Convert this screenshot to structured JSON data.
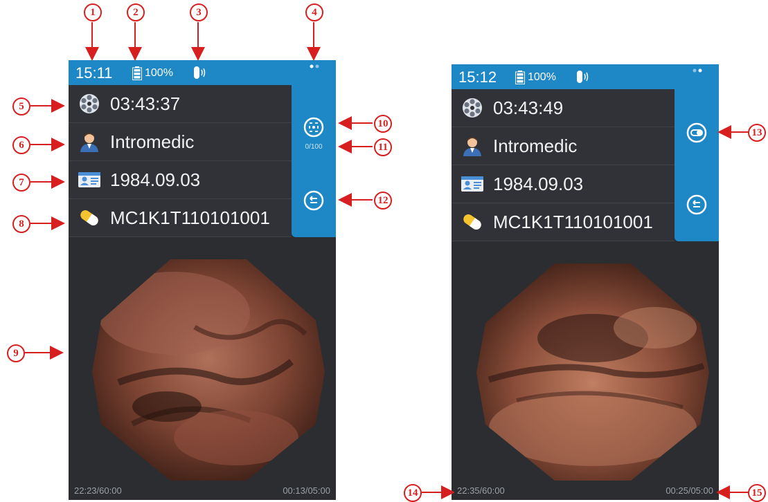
{
  "screen_a": {
    "status": {
      "time": "15:11",
      "battery": "100%"
    },
    "rows": [
      {
        "icon": "film-reel-icon",
        "text": "03:43:37"
      },
      {
        "icon": "user-avatar-icon",
        "text": "Intromedic"
      },
      {
        "icon": "id-card-icon",
        "text": "1984.09.03"
      },
      {
        "icon": "capsule-icon",
        "text": "MC1K1T110101001"
      }
    ],
    "side": {
      "counter": "0/100"
    },
    "footer": {
      "left": "22:23/60:00",
      "right": "00:13/05:00"
    }
  },
  "screen_b": {
    "status": {
      "time": "15:12",
      "battery": "100%"
    },
    "rows": [
      {
        "icon": "film-reel-icon",
        "text": "03:43:49"
      },
      {
        "icon": "user-avatar-icon",
        "text": "Intromedic"
      },
      {
        "icon": "id-card-icon",
        "text": "1984.09.03"
      },
      {
        "icon": "capsule-icon",
        "text": "MC1K1T110101001"
      }
    ],
    "footer": {
      "left": "22:35/60:00",
      "right": "00:25/05:00"
    }
  },
  "callouts": [
    "1",
    "2",
    "3",
    "4",
    "5",
    "6",
    "7",
    "8",
    "9",
    "10",
    "11",
    "12",
    "13",
    "14",
    "15"
  ],
  "colors": {
    "accent": "#1e88c7",
    "callout": "#d81f1f",
    "screen_bg": "#2b2d31"
  }
}
